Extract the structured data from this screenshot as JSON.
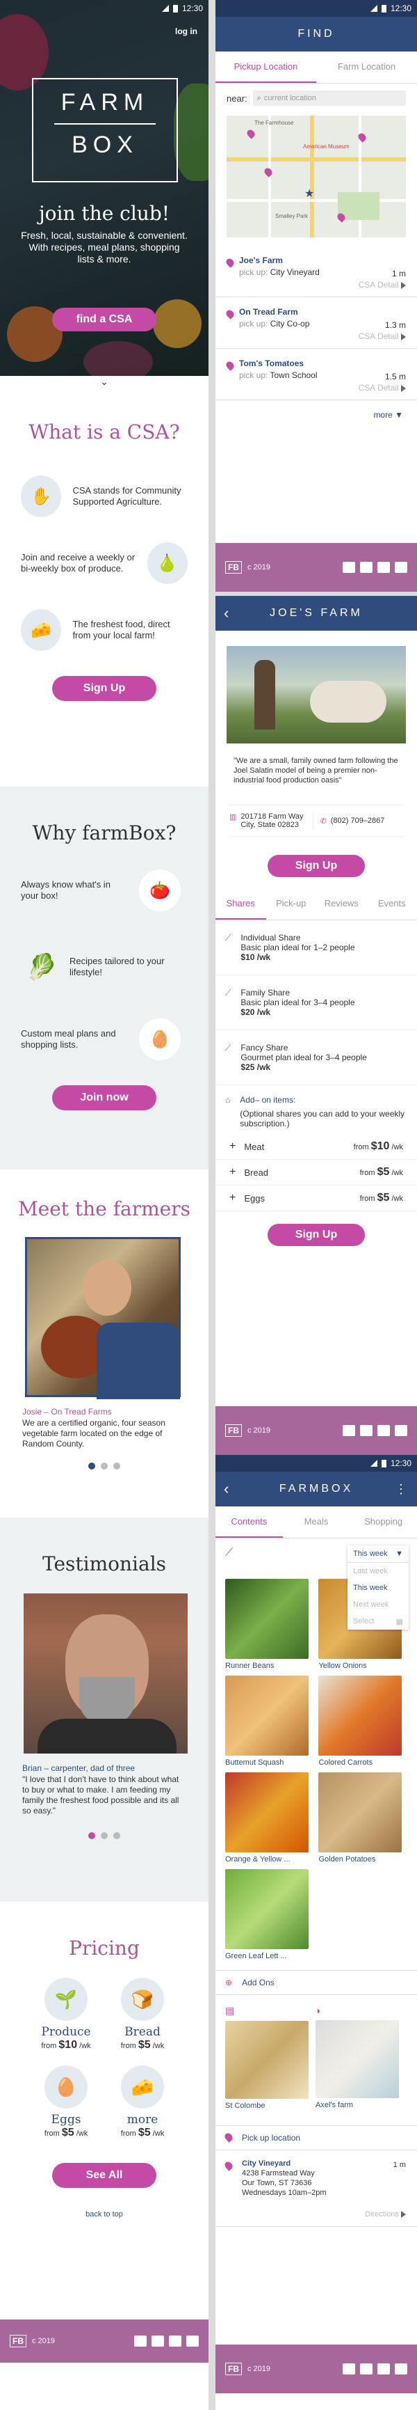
{
  "status_time": "12:30",
  "hero": {
    "login": "log in",
    "logo_top": "FARM",
    "logo_bottom": "BOX",
    "join": "join the club!",
    "tagline": "Fresh, local, sustainable & convenient. With recipes, meal plans, shopping lists & more.",
    "cta": "find a CSA"
  },
  "csa": {
    "title": "What is a CSA?",
    "items": [
      "CSA stands for Community Supported Agriculture.",
      "Join and receive a weekly or bi-weekly box of produce.",
      "The freshest food, direct from your local farm!"
    ],
    "cta": "Sign Up"
  },
  "why": {
    "title": "Why farmBox?",
    "items": [
      "Always know what's in your box!",
      "Recipes tailored to your lifestyle!",
      "Custom meal plans and shopping lists."
    ],
    "cta": "Join now"
  },
  "farmers": {
    "title": "Meet the farmers",
    "name": "Josie – On Tread Farms",
    "desc": "\"I love that I don't have to think about what to buy or what to make. I am feeding my family the freshest food possible and its all so easy.\"",
    "desc_real": "We are a certified organic, four season vegetable farm located on the edge of Random County."
  },
  "testimonials": {
    "title": "Testimonials",
    "name": "Brian – carpenter, dad of three",
    "quote": "\"I love that I don't have to think about what to buy or what to make. I am feeding my family the freshest food possible and its all so easy.\""
  },
  "pricing": {
    "title": "Pricing",
    "items": [
      {
        "name": "Produce",
        "from": "from",
        "price": "$10",
        "unit": "/wk"
      },
      {
        "name": "Bread",
        "from": "from",
        "price": "$5",
        "unit": "/wk"
      },
      {
        "name": "Eggs",
        "from": "from",
        "price": "$5",
        "unit": "/wk"
      },
      {
        "name": "more",
        "from": "from",
        "price": "$5",
        "unit": "/wk"
      }
    ],
    "cta": "See All",
    "back": "back to top"
  },
  "footer": {
    "logo": "FB",
    "copy": "c 2019"
  },
  "find": {
    "title": "FIND",
    "tabs": [
      "Pickup Location",
      "Farm Location"
    ],
    "near": "near:",
    "placeholder": "current location",
    "map_labels": [
      "The Farmhouse",
      "American Museum",
      "Smalley Park"
    ],
    "locations": [
      {
        "name": "Joe's Farm",
        "pick": "pick up:",
        "where": "City Vineyard",
        "dist": "1 m",
        "det": "CSA Detail"
      },
      {
        "name": "On Tread Farm",
        "pick": "pick up:",
        "where": "City Co-op",
        "dist": "1.3 m",
        "det": "CSA Detail"
      },
      {
        "name": "Tom's Tomatoes",
        "pick": "pick up:",
        "where": "Town School",
        "dist": "1.5 m",
        "det": "CSA Detail"
      }
    ],
    "more": "more"
  },
  "joes": {
    "title": "JOE'S FARM",
    "desc": "\"We are a small, family owned farm following the Joel Salatin model of being a premier non-industrial food production oasis\"",
    "addr1": "201718 Farm Way",
    "addr2": "City, State 02823",
    "phone": "(802) 709–2867",
    "cta": "Sign Up",
    "tabs": [
      "Shares",
      "Pick-up",
      "Reviews",
      "Events"
    ],
    "shares": [
      {
        "t": "Individual Share",
        "d": "Basic plan ideal for 1–2 people",
        "p": "$10 /wk"
      },
      {
        "t": "Family Share",
        "d": "Basic plan ideal for 3–4 people",
        "p": "$20 /wk"
      },
      {
        "t": "Fancy Share",
        "d": "Gourmet plan ideal for 3–4 people",
        "p": "$25 /wk"
      }
    ],
    "addons_title": "Add– on items:",
    "addons_note": "(Optional shares you can add to your weekly subscription.)",
    "addons": [
      {
        "n": "Meat",
        "from": "from",
        "p": "$10",
        "u": "/wk"
      },
      {
        "n": "Bread",
        "from": "from",
        "p": "$5",
        "u": "/wk"
      },
      {
        "n": "Eggs",
        "from": "from",
        "p": "$5",
        "u": "/wk"
      }
    ],
    "cta2": "Sign Up"
  },
  "farmbox": {
    "title": "FARMBOX",
    "tabs": [
      "Contents",
      "Meals",
      "Shopping"
    ],
    "week_sel": "This week",
    "week_opts": [
      "Last week",
      "This week",
      "Next week",
      "Select"
    ],
    "products": [
      "Runner Beans",
      "Yellow Onions",
      "Buttemut Squash",
      "Colored Carrots",
      "Orange & Yellow ...",
      "Golden Potatoes",
      "Green Leaf Lett ..."
    ],
    "addons_label": "Add Ons",
    "addons": [
      "St Colombe",
      "Axel's farm"
    ],
    "pickup_label": "Pick up location",
    "pickup_name": "City Vineyard",
    "pickup_addr": "4238 Farmstead Way",
    "pickup_city": "Our Town, ST 73636",
    "pickup_time": "Wednesdays 10am–2pm",
    "pickup_dist": "1 m",
    "directions": "Directions"
  }
}
